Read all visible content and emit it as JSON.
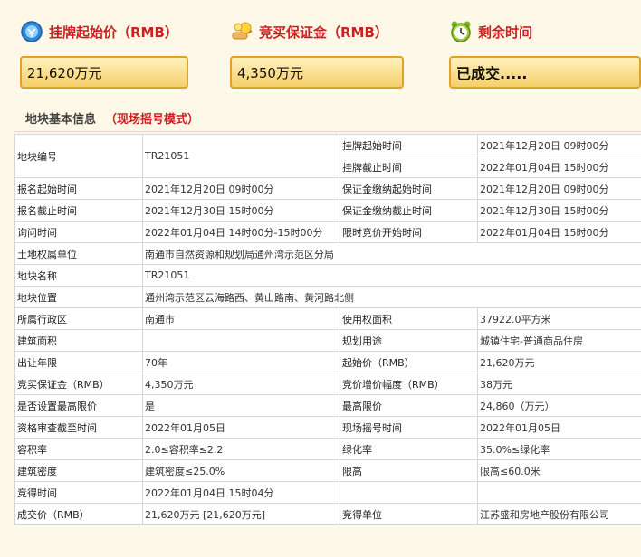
{
  "stats": {
    "start_price": {
      "label": "挂牌起始价（RMB）",
      "value": "21,620万元",
      "icon": "money-bag-icon"
    },
    "deposit": {
      "label": "竞买保证金（RMB）",
      "value": "4,350万元",
      "icon": "hand-coins-icon"
    },
    "time_left": {
      "label": "剩余时间",
      "value": "已成交.....",
      "icon": "alarm-clock-icon"
    }
  },
  "section": {
    "title": "地块基本信息",
    "mode": "（现场摇号模式）"
  },
  "table": {
    "parcel_no_label": "地块编号",
    "parcel_no": "TR21051",
    "list_start_label": "挂牌起始时间",
    "list_start": "2021年12月20日 09时00分",
    "list_end_label": "挂牌截止时间",
    "list_end": "2022年01月04日 15时00分",
    "reg_start_label": "报名起始时间",
    "reg_start": "2021年12月20日 09时00分",
    "dep_start_label": "保证金缴纳起始时间",
    "dep_start": "2021年12月20日 09时00分",
    "reg_end_label": "报名截止时间",
    "reg_end": "2021年12月30日 15时00分",
    "dep_end_label": "保证金缴纳截止时间",
    "dep_end": "2021年12月30日 15时00分",
    "inquiry_label": "询问时间",
    "inquiry": "2022年01月04日 14时00分-15时00分",
    "bid_start_label": "限时竞价开始时间",
    "bid_start": "2022年01月04日 15时00分",
    "owner_label": "土地权属单位",
    "owner": "南通市自然资源和规划局通州湾示范区分局",
    "name_label": "地块名称",
    "name": "TR21051",
    "location_label": "地块位置",
    "location": "通州湾示范区云海路西、黄山路南、黄河路北侧",
    "district_label": "所属行政区",
    "district": "南通市",
    "area_label": "使用权面积",
    "area": "37922.0平方米",
    "build_area_label": "建筑面积",
    "build_area": "",
    "usage_label": "规划用途",
    "usage": "城镇住宅-普通商品住房",
    "term_label": "出让年限",
    "term": "70年",
    "start_price_label": "起始价（RMB）",
    "start_price": "21,620万元",
    "deposit_label": "竞买保证金（RMB）",
    "deposit": "4,350万元",
    "increment_label": "竞价增价幅度（RMB）",
    "increment": "38万元",
    "has_max_label": "是否设置最高限价",
    "has_max": "是",
    "max_price_label": "最高限价",
    "max_price": "24,860（万元）",
    "review_deadline_label": "资格审查截至时间",
    "review_deadline": "2022年01月05日",
    "lottery_time_label": "现场摇号时间",
    "lottery_time": "2022年01月05日",
    "far_label": "容积率",
    "far": "2.0≤容积率≤2.2",
    "green_label": "绿化率",
    "green": "35.0%≤绿化率",
    "density_label": "建筑密度",
    "density": "建筑密度≤25.0%",
    "height_label": "限高",
    "height": "限高≤60.0米",
    "won_time_label": "竞得时间",
    "won_time": "2022年01月04日 15时04分",
    "deal_price_label": "成交价（RMB）",
    "deal_price": "21,620万元 [21,620万元]",
    "winner_label": "竞得单位",
    "winner": "江苏盛和房地产股份有限公司"
  }
}
